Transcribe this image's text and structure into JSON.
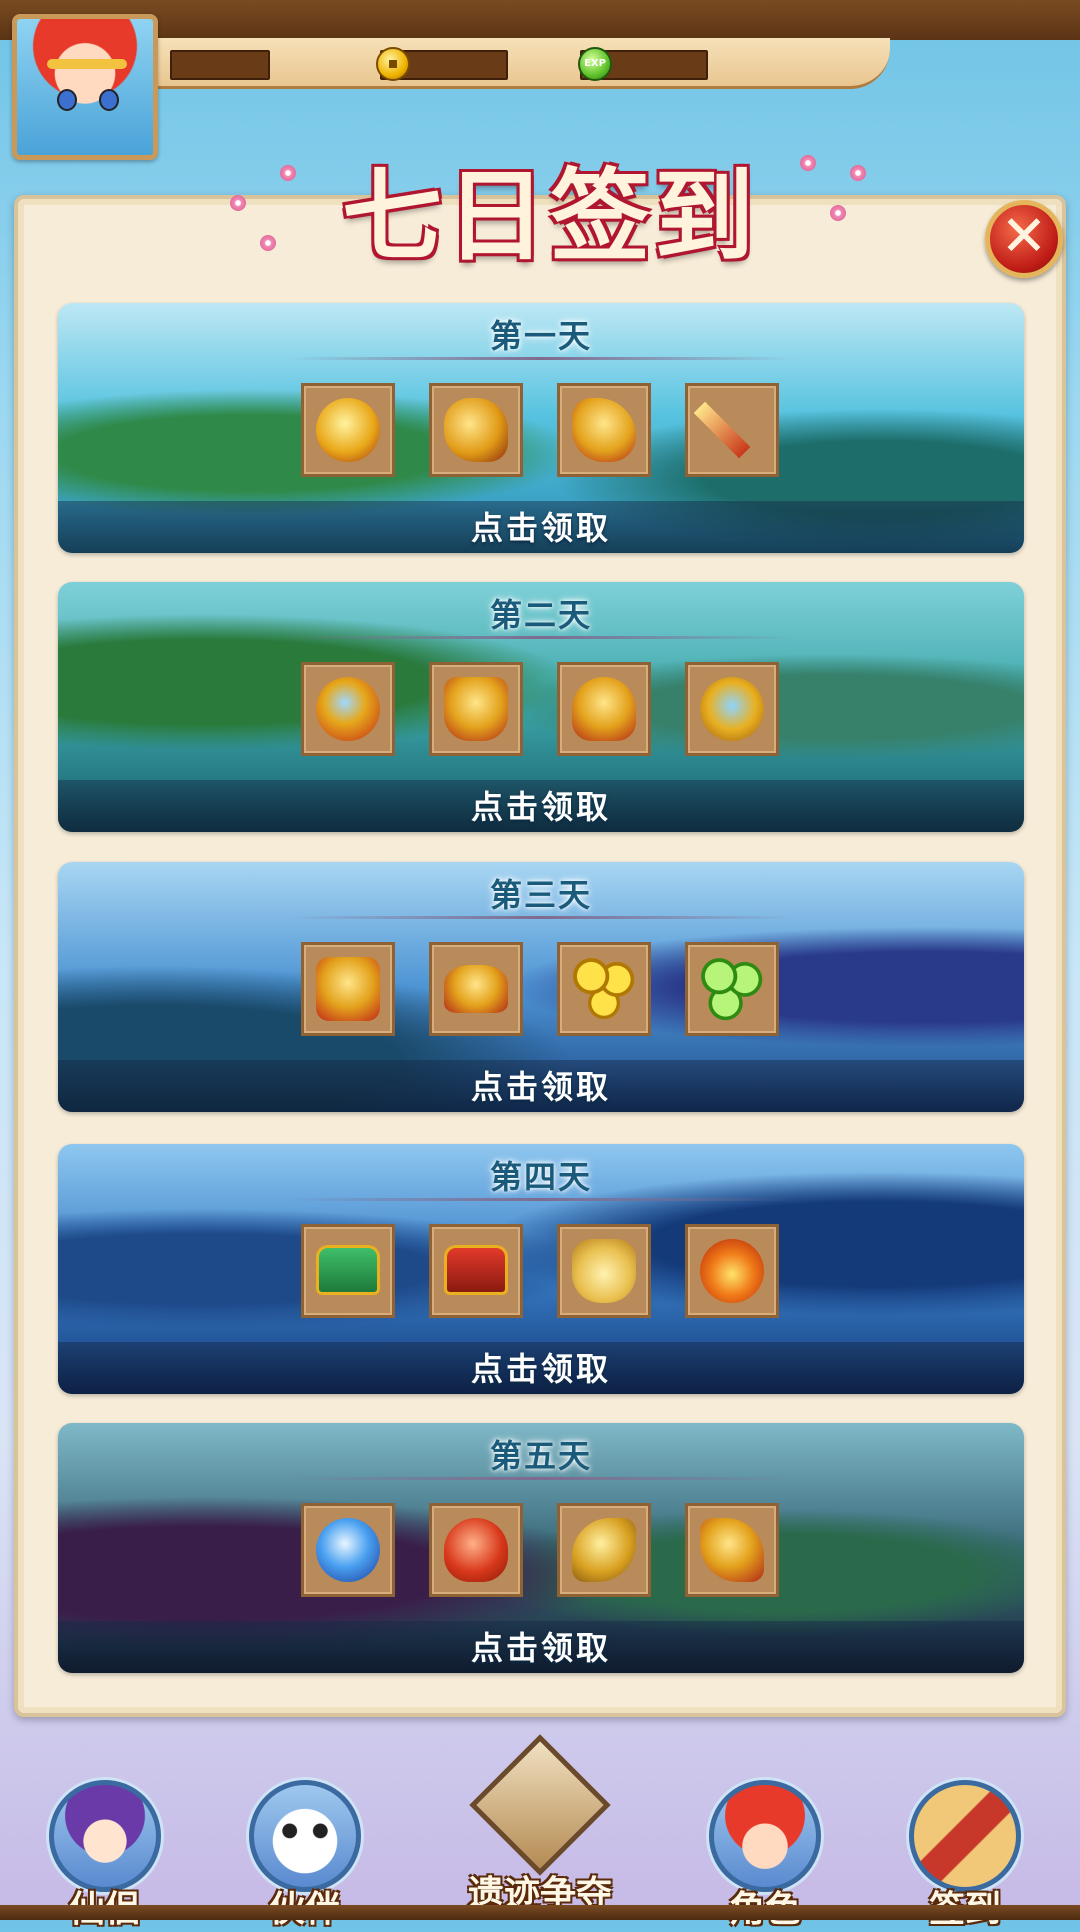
{
  "header": {
    "resources": [
      {
        "name": "gold",
        "icon": "coin-icon",
        "value": ""
      },
      {
        "name": "exp",
        "icon": "exp-icon",
        "icon_text": "EXP",
        "value": ""
      }
    ]
  },
  "panel": {
    "title": "七日签到",
    "close_icon": "close-icon"
  },
  "days": [
    {
      "title": "第一天",
      "claim_label": "点击领取",
      "items": [
        "golden-helmet-icon",
        "golden-gauntlet-icon",
        "golden-boots-icon",
        "golden-sword-icon"
      ]
    },
    {
      "title": "第二天",
      "claim_label": "点击领取",
      "items": [
        "golden-ring-icon",
        "golden-armor-icon",
        "golden-helmet-icon",
        "golden-amulet-icon"
      ]
    },
    {
      "title": "第三天",
      "claim_label": "点击领取",
      "items": [
        "golden-belt-icon",
        "golden-crown-icon",
        "gold-coins-icon",
        "exp-orbs-icon"
      ]
    },
    {
      "title": "第四天",
      "claim_label": "点击领取",
      "items": [
        "green-chest-icon",
        "red-chest-icon",
        "gold-pouch-icon",
        "fire-orb-icon"
      ]
    },
    {
      "title": "第五天",
      "claim_label": "点击领取",
      "items": [
        "blue-orb-icon",
        "red-gourd-icon",
        "golden-shoulder-icon",
        "golden-wing-icon"
      ]
    }
  ],
  "nav": {
    "items": [
      {
        "label": "仙侣",
        "icon": "fairy-avatar-icon"
      },
      {
        "label": "伙伴",
        "icon": "panda-avatar-icon"
      },
      {
        "label": "遗迹争夺",
        "icon": "crossed-swords-icon"
      },
      {
        "label": "角色",
        "icon": "hero-avatar-icon"
      },
      {
        "label": "签到",
        "icon": "checkin-scroll-icon"
      }
    ]
  },
  "colors": {
    "panel_bg": "#f6ecd8",
    "title_outline": "#b0162f",
    "day_title": "#1a5a7a",
    "item_slot": "#b98a5a"
  }
}
